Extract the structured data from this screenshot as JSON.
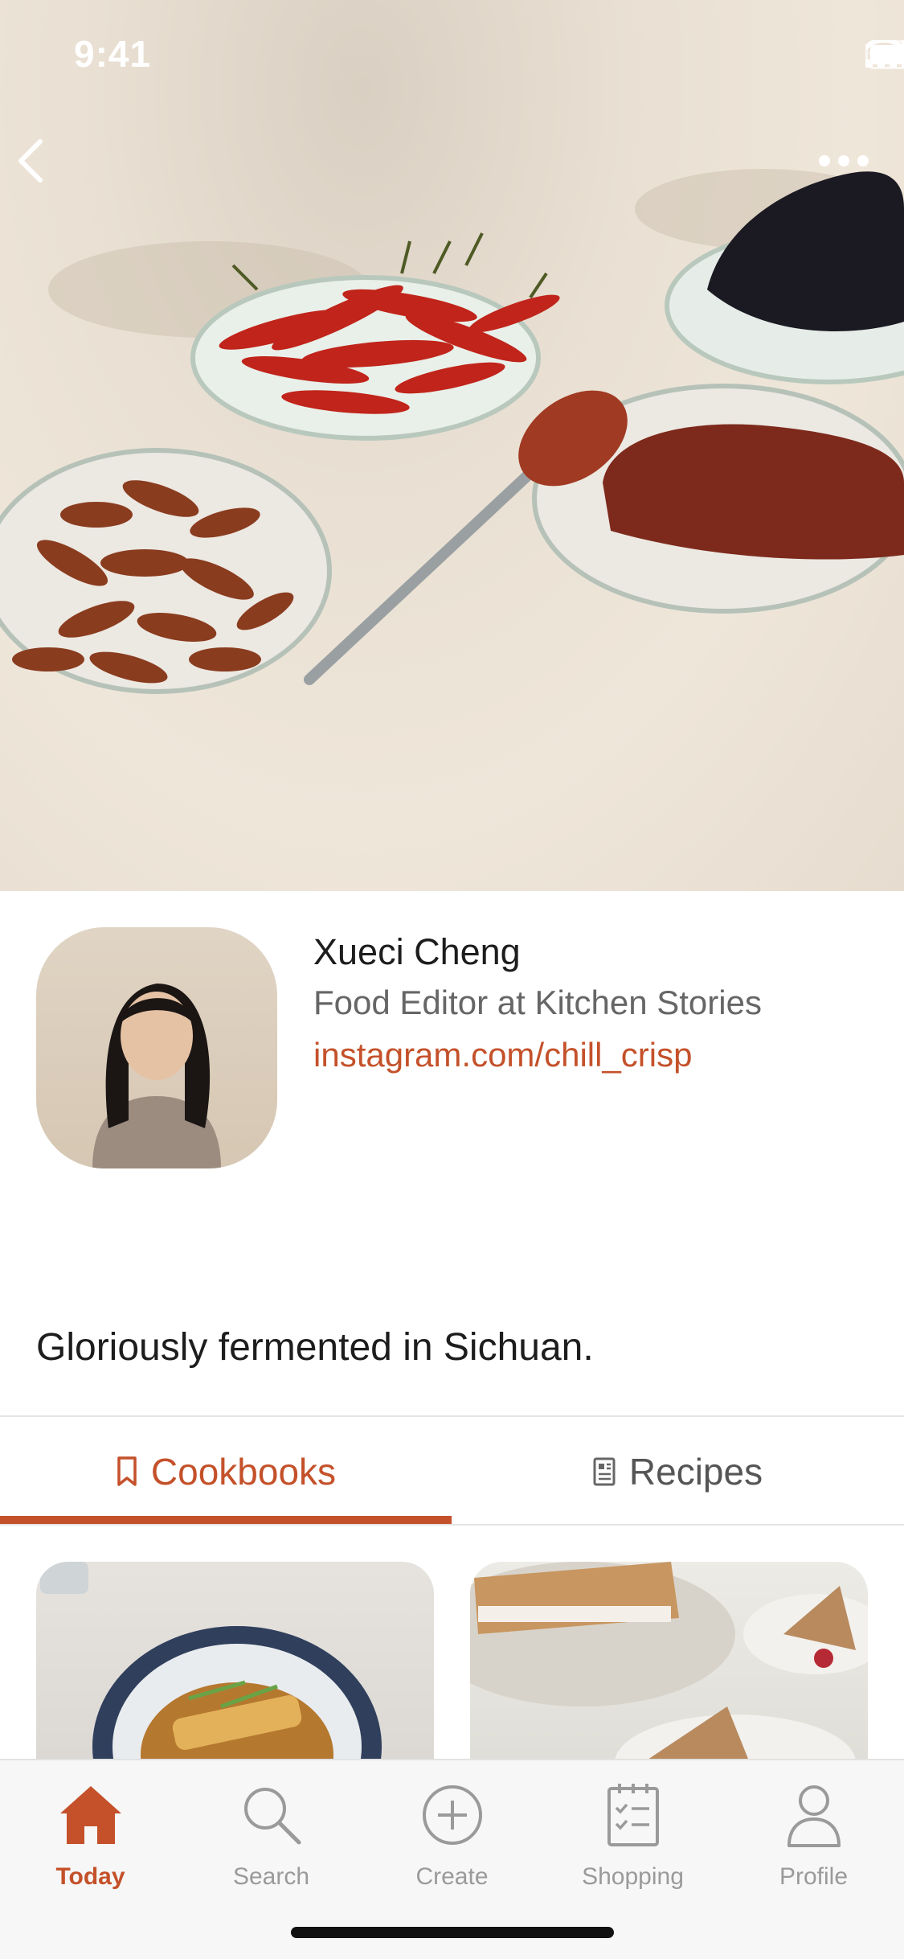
{
  "status_bar": {
    "time": "9:41"
  },
  "profile": {
    "name": "Xueci Cheng",
    "role": "Food Editor at Kitchen Stories",
    "link": "instagram.com/chill_crisp",
    "bio": "Gloriously fermented in Sichuan."
  },
  "tabs": [
    {
      "label": "Cookbooks",
      "icon": "bookmark-icon",
      "active": true
    },
    {
      "label": "Recipes",
      "icon": "recipe-card-icon",
      "active": false
    }
  ],
  "nav": [
    {
      "label": "Today",
      "icon": "home-icon",
      "active": true
    },
    {
      "label": "Search",
      "icon": "search-icon",
      "active": false
    },
    {
      "label": "Create",
      "icon": "plus-circle-icon",
      "active": false
    },
    {
      "label": "Shopping",
      "icon": "shopping-list-icon",
      "active": false
    },
    {
      "label": "Profile",
      "icon": "person-icon",
      "active": false
    }
  ],
  "colors": {
    "accent": "#c4512a",
    "inactive": "#9a9a9a"
  }
}
